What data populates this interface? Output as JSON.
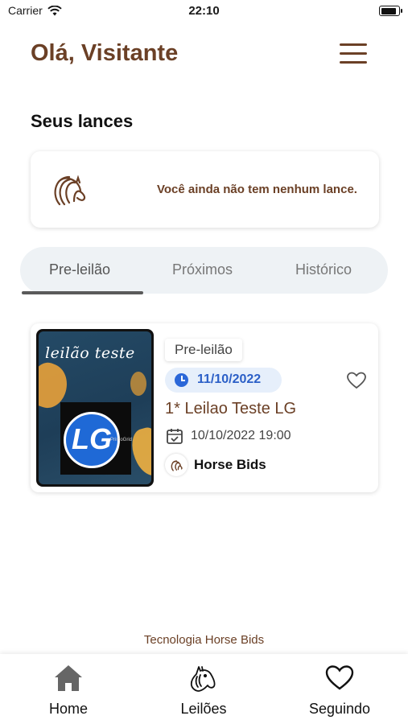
{
  "status_bar": {
    "carrier": "Carrier",
    "time": "22:10",
    "battery_level": 0.9
  },
  "header": {
    "greeting": "Olá, Visitante"
  },
  "bids": {
    "title": "Seus lances",
    "empty_message": "Você ainda não tem nenhum lance."
  },
  "tabs": [
    {
      "label": "Pre-leilão",
      "active": true
    },
    {
      "label": "Próximos",
      "active": false
    },
    {
      "label": "Histórico",
      "active": false
    }
  ],
  "auction": {
    "thumbnail_title": "leilão teste",
    "thumbnail_logo": "LG",
    "thumbnail_logo_sub": "PrimoGrid",
    "status_badge": "Pre-leilão",
    "date": "11/10/2022",
    "name": "1* Leilao Teste LG",
    "datetime": "10/10/2022 19:00",
    "organizer": "Horse Bids"
  },
  "footer": {
    "credit": "Tecnologia Horse Bids"
  },
  "bottom_nav": [
    {
      "label": "Home",
      "icon": "home-icon"
    },
    {
      "label": "Leilões",
      "icon": "horse-head-icon"
    },
    {
      "label": "Seguindo",
      "icon": "heart-icon"
    }
  ],
  "colors": {
    "brand_brown": "#6b4026",
    "accent_blue": "#2b67d8",
    "tab_bg": "#eef2f5"
  }
}
